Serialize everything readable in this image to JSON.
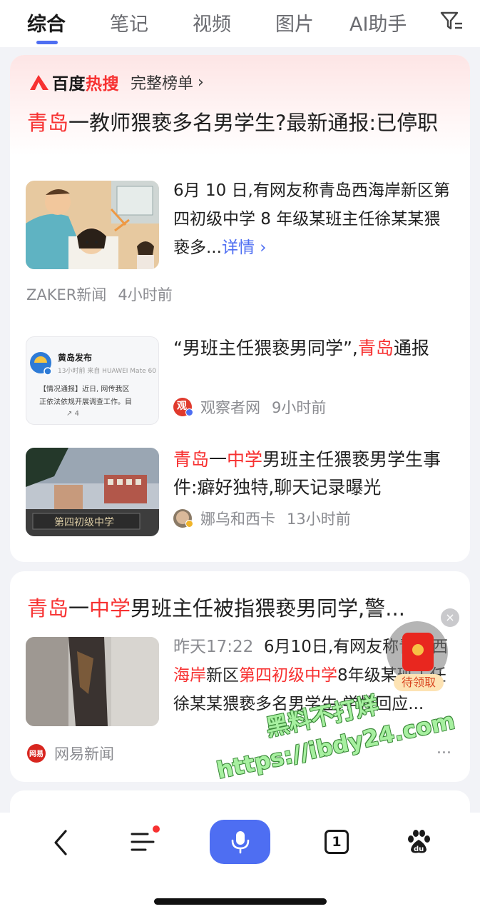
{
  "tabs": {
    "items": [
      {
        "label": "综合",
        "active": true
      },
      {
        "label": "笔记"
      },
      {
        "label": "视频"
      },
      {
        "label": "图片"
      },
      {
        "label": "AI助手"
      }
    ],
    "filter_icon": "filter-icon"
  },
  "hot_card": {
    "logo_text_a": "百度",
    "logo_text_b": "热搜",
    "full_list_label": "完整榜单",
    "headline": {
      "highlight": "青岛",
      "rest": "一教师猥亵多名男学生?最新通报:已停职"
    },
    "summary": "6月 10 日,有网友称青岛西海岸新区第四初级中学 8 年级某班主任徐某某猥亵多...",
    "more_label": "详情",
    "source": "ZAKER新闻",
    "time": "4小时前",
    "thumb_text": {
      "account": "黄岛发布",
      "meta": "13小时前 来自 HUAWEI Mate 60",
      "line1": "【情况通报】近日, 网传我区",
      "line2": "正依法依规开展调查工作。目",
      "reposts": "4"
    },
    "related": [
      {
        "title_pre": "“男班主任猥亵男同学”,",
        "title_hl": "青岛",
        "title_post": "通报",
        "source": "观察者网",
        "time": "9小时前"
      },
      {
        "title_hl1": "青岛",
        "title_mid": "一",
        "title_hl2": "中学",
        "title_post": "男班主任猥亵男学生事件:癖好独特,聊天记录曝光",
        "source": "娜乌和西卡",
        "time": "13小时前"
      }
    ]
  },
  "result2": {
    "title_hl1": "青岛",
    "title_mid": "一",
    "title_hl2": "中学",
    "title_post": "男班主任被指猥亵男同学,警...",
    "date": "昨天17:22",
    "snippet_a": "6月10日,有网友称青岛西",
    "snippet_hl1": "海岸",
    "snippet_b": "新区",
    "snippet_hl2": "第四初级中学",
    "snippet_c": "8年级某班主任徐某某猥亵多名男学生,学校回应...",
    "source": "网易新闻",
    "more_dots": "..."
  },
  "float_packet": {
    "label": "待领取",
    "close": "×"
  },
  "watermark": {
    "line1": "黑料不打烊",
    "line2": "https://ibdy24.com"
  },
  "bottom_bar": {
    "tab_count": "1",
    "icons": [
      "back-icon",
      "menu-icon",
      "microphone-icon",
      "tabs-icon",
      "baidu-paw-icon"
    ]
  },
  "colors": {
    "accent": "#4e6ef2",
    "highlight_red": "#f73131"
  }
}
